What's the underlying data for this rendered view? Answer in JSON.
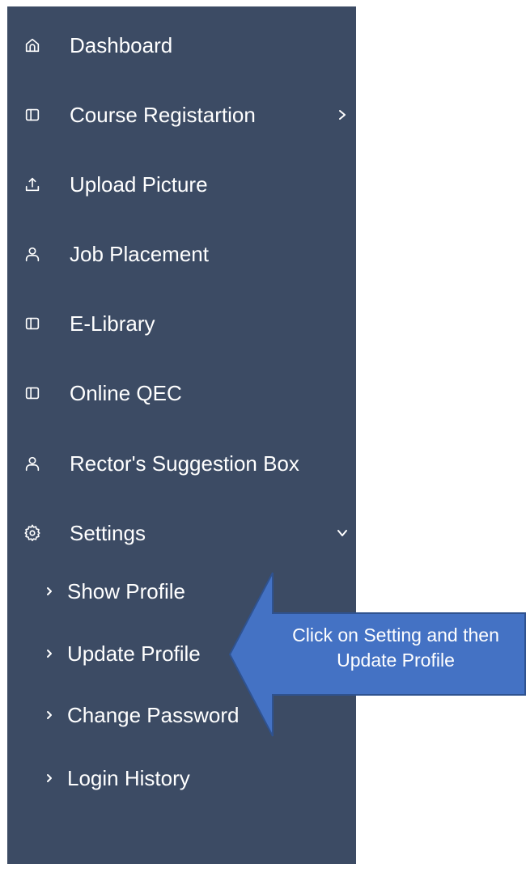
{
  "sidebar": {
    "background": "#3c4b64",
    "items": [
      {
        "label": "Dashboard",
        "icon": "home-icon"
      },
      {
        "label": "Course Registartion",
        "icon": "panel-icon",
        "caret": "chevron-right-icon"
      },
      {
        "label": "Upload Picture",
        "icon": "upload-icon"
      },
      {
        "label": "Job Placement",
        "icon": "user-icon"
      },
      {
        "label": "E-Library",
        "icon": "panel-icon"
      },
      {
        "label": "Online QEC",
        "icon": "panel-icon"
      },
      {
        "label": "Rector's Suggestion Box",
        "icon": "user-icon"
      },
      {
        "label": "Settings",
        "icon": "gear-icon",
        "caret": "chevron-down-icon"
      }
    ],
    "settings_submenu": [
      {
        "label": "Show Profile"
      },
      {
        "label": "Update Profile"
      },
      {
        "label": "Change Password"
      },
      {
        "label": "Login History"
      }
    ]
  },
  "callout": {
    "line1": "Click on Setting and then",
    "line2": "Update Profile",
    "color": "#4472c4",
    "border_color": "#2f528f"
  }
}
